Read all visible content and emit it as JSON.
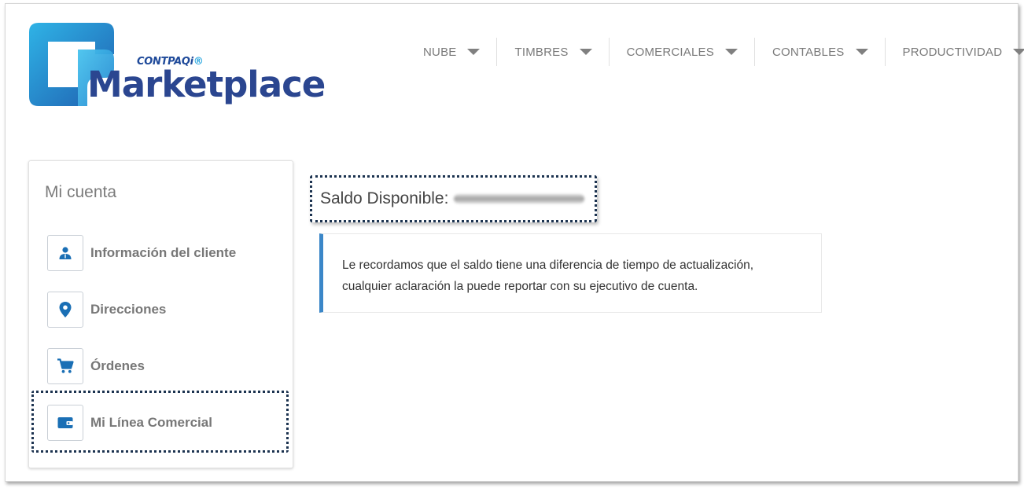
{
  "brand": {
    "small": "CONTPAQi",
    "dot": "®",
    "name": "Marketplace",
    "colors": {
      "dark_blue": "#2b4690",
      "light_blue": "#2aa7e0"
    }
  },
  "nav": [
    {
      "label": "NUBE"
    },
    {
      "label": "TIMBRES"
    },
    {
      "label": "COMERCIALES"
    },
    {
      "label": "CONTABLES"
    },
    {
      "label": "PRODUCTIVIDAD"
    }
  ],
  "sidebar": {
    "title": "Mi cuenta",
    "items": [
      {
        "label": "Información del cliente",
        "icon": "user-icon"
      },
      {
        "label": "Direcciones",
        "icon": "map-pin-icon"
      },
      {
        "label": "Órdenes",
        "icon": "cart-icon"
      },
      {
        "label": "Mi Línea Comercial",
        "icon": "wallet-icon",
        "highlighted": true
      }
    ],
    "icon_color": "#1a6fb5"
  },
  "balance": {
    "label": "Saldo Disponible:"
  },
  "notice": {
    "line1": "Le recordamos que el saldo tiene una diferencia de tiempo de actualización,",
    "line2": "cualquier aclaración la puede reportar con su ejecutivo de cuenta.",
    "accent": "#3b87c8"
  }
}
